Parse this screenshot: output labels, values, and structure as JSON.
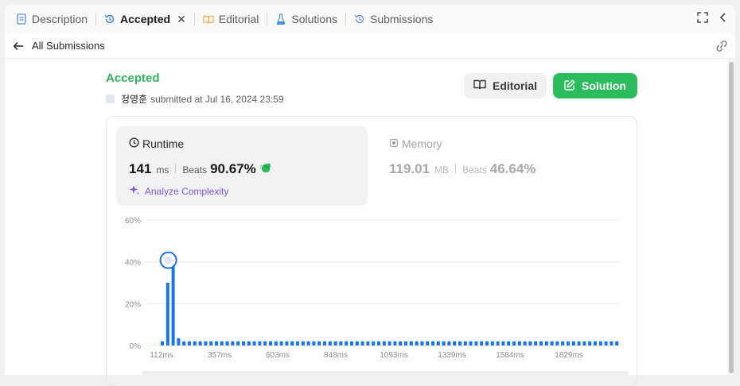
{
  "tabs": [
    {
      "label": "Description",
      "icon": "description-icon"
    },
    {
      "label": "Accepted",
      "icon": "history-icon",
      "active": true,
      "close": "✕"
    },
    {
      "label": "Editorial",
      "icon": "book-icon"
    },
    {
      "label": "Solutions",
      "icon": "flask-icon"
    },
    {
      "label": "Submissions",
      "icon": "history-icon"
    }
  ],
  "subheader": {
    "back_label": "All Submissions"
  },
  "submission": {
    "status": "Accepted",
    "user": "정영훈",
    "submitted_text": "submitted at Jul 16, 2024 23:59"
  },
  "buttons": {
    "editorial": "Editorial",
    "solution": "Solution"
  },
  "runtime": {
    "title": "Runtime",
    "value": "141",
    "unit": "ms",
    "beats_label": "Beats",
    "beats_pct": "90.67%",
    "analyze": "Analyze Complexity"
  },
  "memory": {
    "title": "Memory",
    "value": "119.01",
    "unit": "MB",
    "beats_label": "Beats",
    "beats_pct": "46.64%"
  },
  "colors": {
    "accent_green": "#2cbb5d",
    "bar_blue": "#1a73e8",
    "purple": "#7f56d9"
  },
  "chart_data": {
    "type": "bar",
    "y_ticks": [
      "60%",
      "40%",
      "20%",
      "0%"
    ],
    "ylim": [
      0,
      60
    ],
    "x_ticks": [
      "112ms",
      "357ms",
      "603ms",
      "848ms",
      "1093ms",
      "1339ms",
      "1584ms",
      "1829ms"
    ],
    "highlight_index": 2,
    "values": [
      2,
      30,
      40,
      3.5,
      2,
      2,
      2,
      2,
      2,
      2,
      2,
      2,
      2,
      2,
      2,
      2,
      2,
      2,
      2,
      2,
      2,
      2,
      2,
      2,
      2,
      2,
      2,
      2,
      2,
      2,
      2,
      2,
      2,
      2,
      2,
      2,
      2,
      2,
      2,
      2,
      2,
      2,
      2,
      2,
      2,
      2,
      2,
      2,
      2,
      2,
      2,
      2,
      2,
      2,
      2,
      2,
      2,
      2,
      2,
      2,
      2,
      2,
      2,
      2,
      2,
      2,
      2,
      2,
      2,
      2,
      2,
      2,
      2,
      2,
      2,
      2,
      2,
      2,
      2,
      2,
      2,
      2,
      2,
      2,
      2
    ]
  }
}
